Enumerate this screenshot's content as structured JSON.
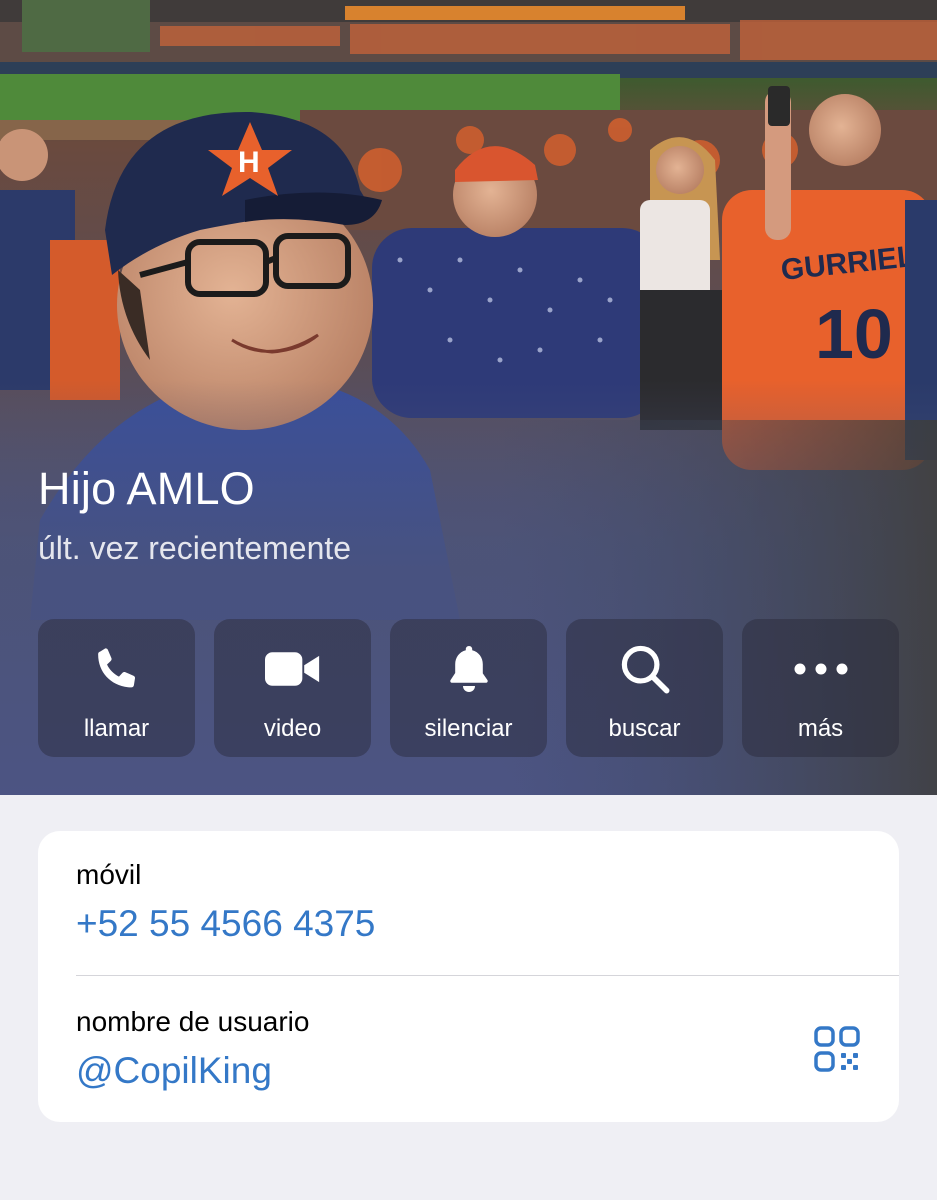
{
  "profile": {
    "name": "Hijo AMLO",
    "status": "últ. vez recientemente"
  },
  "actions": [
    {
      "label": "llamar",
      "icon": "phone-icon"
    },
    {
      "label": "video",
      "icon": "video-camera-icon"
    },
    {
      "label": "silenciar",
      "icon": "bell-icon"
    },
    {
      "label": "buscar",
      "icon": "search-icon"
    },
    {
      "label": "más",
      "icon": "more-dots-icon"
    }
  ],
  "info": {
    "phone_label": "móvil",
    "phone_value": "+52 55 4566 4375",
    "username_label": "nombre de usuario",
    "username_value": "@CopilKing",
    "qr_icon": "qr-code-icon"
  },
  "photo_text": {
    "jersey_name": "GURRIEL",
    "jersey_number": "10",
    "cap_letter": "H"
  },
  "colors": {
    "link": "#3478c7",
    "astros_orange": "#e8612c",
    "astros_navy": "#1f2a4e",
    "page_bg": "#efeff4",
    "card_bg": "#ffffff"
  }
}
